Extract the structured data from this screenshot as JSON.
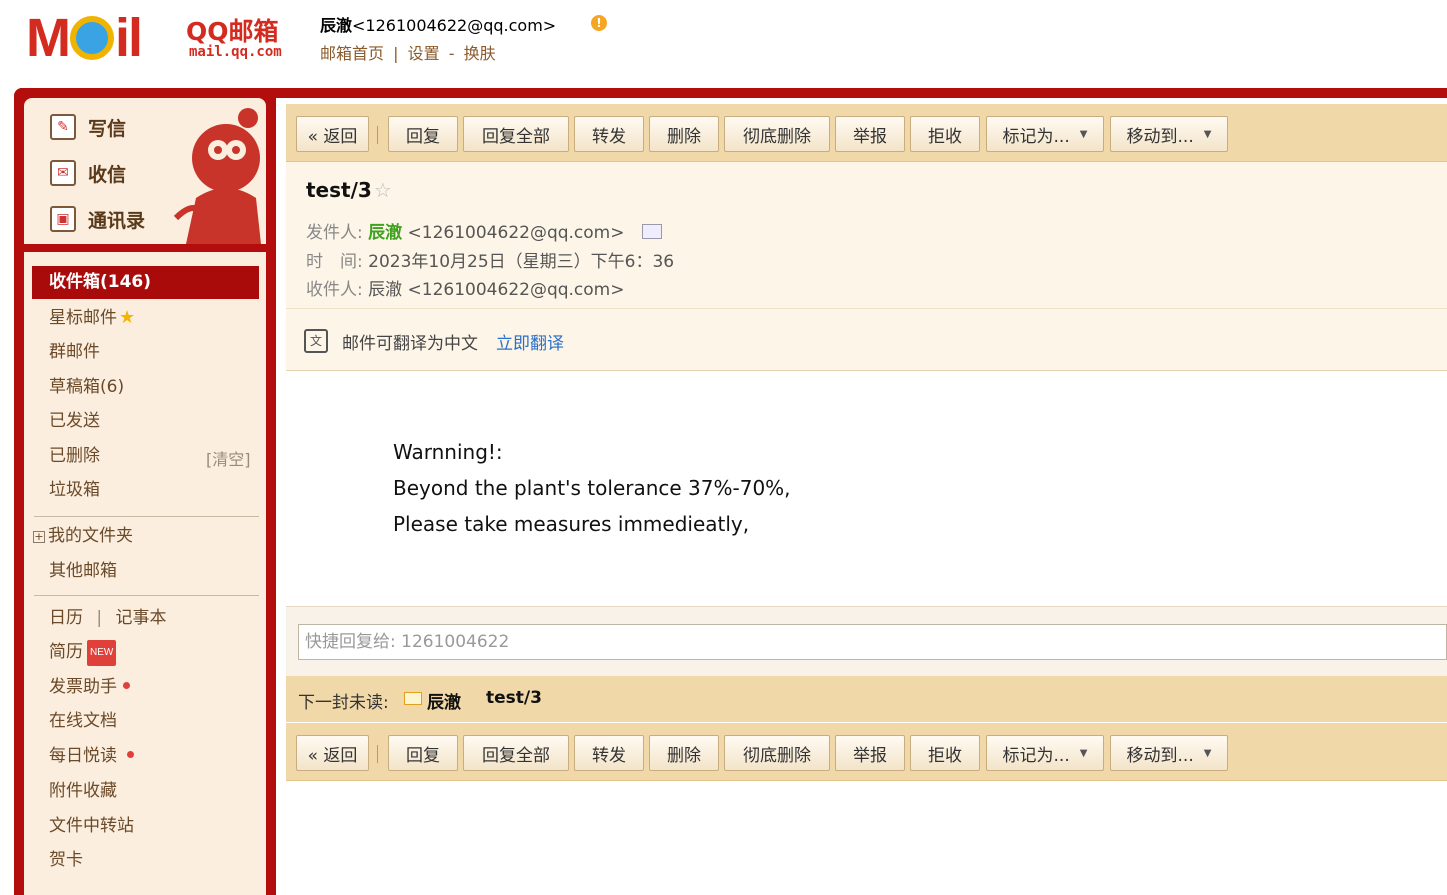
{
  "header": {
    "logo_text": "MOil",
    "brand": "QQ邮箱",
    "brand_url": "mail.qq.com",
    "user_name": "辰澈",
    "user_email": "<1261004622@qq.com>",
    "links": [
      "邮箱首页",
      "设置",
      "换肤"
    ],
    "link_separators": [
      "|",
      "-"
    ]
  },
  "sidebar": {
    "quick": [
      {
        "label": "写信",
        "icon": "compose-icon"
      },
      {
        "label": "收信",
        "icon": "inbox-receive-icon"
      },
      {
        "label": "通讯录",
        "icon": "contacts-icon"
      }
    ],
    "inbox": "收件箱(146)",
    "items": [
      "星标邮件",
      "群邮件",
      "草稿箱(6)",
      "已发送",
      "已删除",
      "垃圾箱"
    ],
    "clear_label": "[清空]",
    "folders": [
      "我的文件夹",
      "其他邮箱"
    ],
    "tools": {
      "calendar": "日历",
      "sep": "|",
      "notebook": "记事本",
      "resume": "简历",
      "resume_badge": "NEW",
      "invoice": "发票助手",
      "docs": "在线文档",
      "daily": "每日悦读",
      "attachments": "附件收藏",
      "transfer": "文件中转站",
      "card": "贺卡"
    }
  },
  "toolbar": {
    "back": "« 返回",
    "reply": "回复",
    "reply_all": "回复全部",
    "forward": "转发",
    "delete": "删除",
    "delete_forever": "彻底删除",
    "report": "举报",
    "reject": "拒收",
    "mark_as": "标记为...",
    "move_to": "移动到..."
  },
  "email": {
    "subject": "test/3",
    "from_label": "发件人:",
    "from_name": "辰澈",
    "from_email": "<1261004622@qq.com>",
    "time_label": "时　间:",
    "time_value": "2023年10月25日（星期三）下午6：36",
    "to_label": "收件人:",
    "to_value": "辰澈 <1261004622@qq.com>",
    "translate_text": "邮件可翻译为中文",
    "translate_link": "立即翻译",
    "body": [
      "Warnning!:",
      "Beyond the plant's tolerance 37%-70%,",
      "Please take measures immedieatly,"
    ]
  },
  "quick_reply": {
    "placeholder": "快捷回复给: 1261004622"
  },
  "next_unread": {
    "label": "下一封未读:",
    "from": "辰澈",
    "subject": "test/3"
  }
}
